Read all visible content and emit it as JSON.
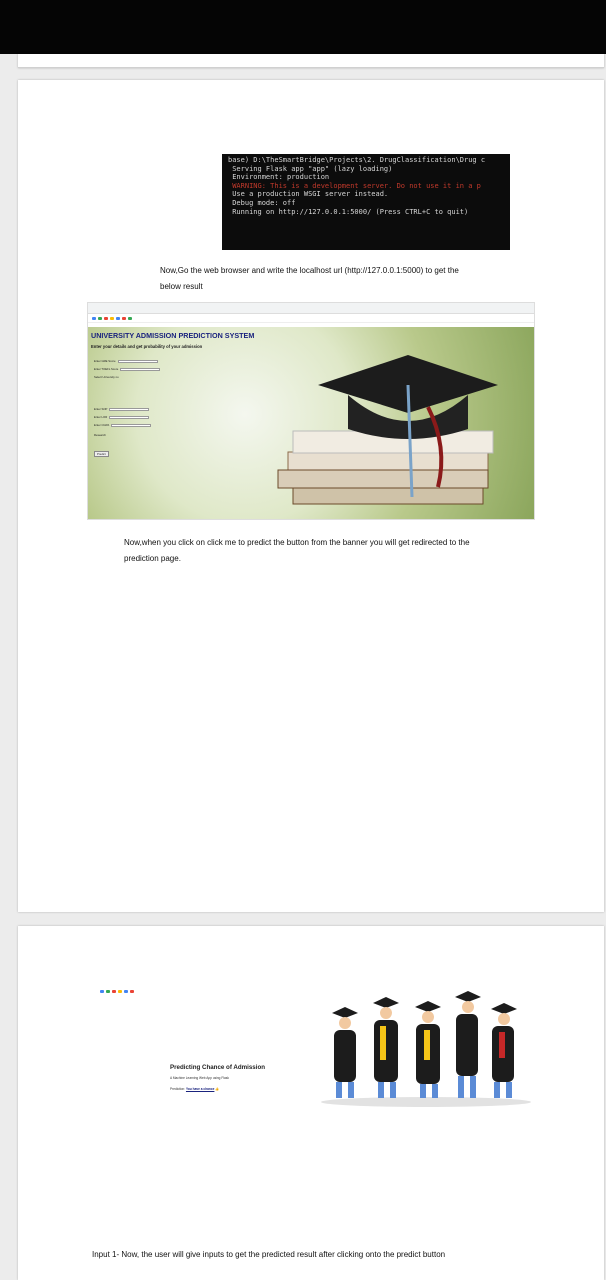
{
  "terminal": {
    "lines": [
      "base) D:\\TheSmartBridge\\Projects\\2. DrugClassification\\Drug c",
      " Serving Flask app \"app\" (lazy loading)",
      " Environment: production",
      " WARNING: This is a development server. Do not use it in a p",
      " Use a production WSGI server instead.",
      " Debug mode: off",
      " Running on http://127.0.0.1:5000/ (Press CTRL+C to quit)"
    ]
  },
  "page1": {
    "instruction_line1": "Now,Go the web browser and write the localhost url (http://127.0.0.1:5000) to get the",
    "instruction_line2": "below result",
    "screenshot": {
      "title": "UNIVERSITY ADMISSION PREDICTION SYSTEM",
      "subtitle": "Enter your details and get probability of your admission",
      "fields": [
        "Enter GRE Score",
        "Enter TOEFL Score",
        "Select University no",
        "Enter SOP",
        "Enter LOR",
        "Enter CGPA",
        "Research"
      ],
      "button": "Predict"
    },
    "click_line1": "Now,when you click on click me to predict the button from the banner you will get redirected to the",
    "click_line2": "prediction page."
  },
  "page2": {
    "screenshot": {
      "title": "Predicting Chance of Admission",
      "subtitle": "A Machine Learning Web App using Flask",
      "prediction_label": "Prediction:",
      "prediction_value": "You have a chance"
    },
    "caption": "Input 1- Now, the user will give inputs to get the predicted result after clicking onto the predict button"
  },
  "colors": {
    "title_blue": "#1a237e",
    "terminal_bg": "#0c0c0c",
    "warning_red": "#c0392b"
  }
}
